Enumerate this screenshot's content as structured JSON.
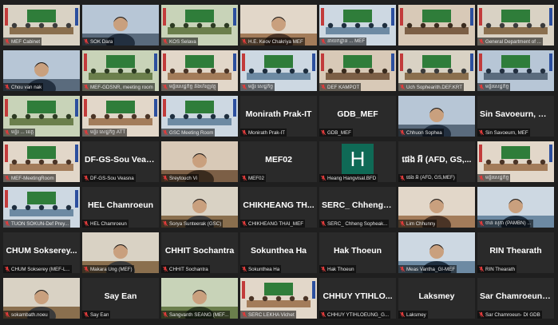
{
  "meeting": {
    "colors": {
      "background": "#1f1f1f",
      "tile": "#2a2a2a",
      "active_speaker": "#f2c230",
      "mic_muted": "#e03b3b"
    },
    "participants": [
      {
        "label": "MEF Cabinet",
        "name": "",
        "video": "video-room",
        "active": false
      },
      {
        "label": "SOK Dara",
        "name": "",
        "video": "video-person",
        "active": false
      },
      {
        "label": "KOS Selava",
        "name": "",
        "video": "video-room",
        "active": false
      },
      {
        "label": "H.E. Keov Chakriya MEF",
        "name": "",
        "video": "video-person",
        "active": false
      },
      {
        "label": "នាយកដ្ឋាន ... MEF",
        "name": "",
        "video": "video-room",
        "active": false
      },
      {
        "label": "",
        "name": "",
        "video": "video-room",
        "active": false
      },
      {
        "label": "General Department of ...",
        "name": "",
        "video": "video-room",
        "active": false
      },
      {
        "label": "Chou van nak",
        "name": "",
        "video": "video-person",
        "active": false
      },
      {
        "label": "MEF-GDSNR, meeting room",
        "name": "",
        "video": "video-room",
        "active": false
      },
      {
        "label": "មន្ទីរសេដ្ឋកិច្ច និងហិរញ្ញវត្ថុ",
        "name": "",
        "video": "video-room",
        "active": false
      },
      {
        "label": "មន្ទីរ សេដ្ឋកិច្ច",
        "name": "",
        "video": "video-room",
        "active": false
      },
      {
        "label": "DEF KAMPOT",
        "name": "",
        "video": "video-room",
        "active": false
      },
      {
        "label": "Uch Sophearith.DEF.KRT",
        "name": "",
        "video": "video-room",
        "active": false
      },
      {
        "label": "មន្ទីរសេដ្ឋកិច្ច",
        "name": "",
        "video": "video-room",
        "active": false
      },
      {
        "label": "មន្ទីរ ... ខេត្ត",
        "name": "",
        "video": "video-room",
        "active": false
      },
      {
        "label": "មន្ទីរ សេដ្ឋកិច្ច ATT",
        "name": "",
        "video": "video-room",
        "active": false
      },
      {
        "label": "GSC Meeting Room",
        "name": "",
        "video": "video-room",
        "active": false
      },
      {
        "label": "Monirath Prak-IT",
        "name": "Monirath Prak-IT",
        "video": "none",
        "active": false
      },
      {
        "label": "GDB_MEF",
        "name": "GDB_MEF",
        "video": "none",
        "active": false
      },
      {
        "label": "Chhuon Sophea",
        "name": "",
        "video": "video-person",
        "active": false
      },
      {
        "label": "Sin Savoeurn, MEF",
        "name": "Sin Savoeurn, M...",
        "video": "none",
        "active": false
      },
      {
        "label": "MEF-MeetingRoom",
        "name": "",
        "video": "video-room",
        "active": false
      },
      {
        "label": "DF-GS-Sou Veasna",
        "name": "DF-GS-Sou Veas...",
        "video": "none",
        "active": false
      },
      {
        "label": "Sreytouch Vi",
        "name": "",
        "video": "video-person",
        "active": false
      },
      {
        "label": "MEF02",
        "name": "MEF02",
        "video": "none",
        "active": false
      },
      {
        "label": "Heang Hangvisal.BFD",
        "name": "",
        "video": "avatar-h",
        "avatar": "H",
        "active": false
      },
      {
        "label": "ផេង អ៊ី (AFD, GS,MEF)",
        "name": "ផេង អ៊ី (AFD, GS,...",
        "video": "none",
        "active": false
      },
      {
        "label": "មន្ទីរសេដ្ឋកិច្ច",
        "name": "",
        "video": "video-room",
        "active": false
      },
      {
        "label": "TUON SOKUN-Def Prey...",
        "name": "",
        "video": "video-room",
        "active": true
      },
      {
        "label": "HEL Chamroeun",
        "name": "HEL Chamroeun",
        "video": "none",
        "active": false
      },
      {
        "label": "Sorya Sunteerak (GSC)",
        "name": "",
        "video": "video-person",
        "active": false
      },
      {
        "label": "CHIKHEANG THAI_MEF",
        "name": "CHIKHEANG TH...",
        "video": "none",
        "active": false
      },
      {
        "label": "SERC_ Chheng Sopheak...",
        "name": "SERC_ Chheng S...",
        "video": "none",
        "active": false
      },
      {
        "label": "Lim Chhunny",
        "name": "",
        "video": "video-person",
        "active": false
      },
      {
        "label": "ចាន់ សុភា (PAMBN) ...",
        "name": "",
        "video": "video-person",
        "active": false
      },
      {
        "label": "CHUM Sokserey (MEF-L...",
        "name": "CHUM Sokserey...",
        "video": "none",
        "active": false
      },
      {
        "label": "Makara Ung (MEF)",
        "name": "",
        "video": "video-person",
        "active": false
      },
      {
        "label": "CHHIT Sochantra",
        "name": "CHHIT Sochantra",
        "video": "none",
        "active": false
      },
      {
        "label": "Sokunthea Ha",
        "name": "Sokunthea Ha",
        "video": "none",
        "active": false
      },
      {
        "label": "Hak Thoeun",
        "name": "Hak Thoeun",
        "video": "none",
        "active": false
      },
      {
        "label": "Meas Vantha_GI-MEF",
        "name": "",
        "video": "video-person",
        "active": false
      },
      {
        "label": "RIN Thearath",
        "name": "RIN Thearath",
        "video": "none",
        "active": false
      },
      {
        "label": "sokambath.noeu",
        "name": "",
        "video": "video-person",
        "active": false
      },
      {
        "label": "Say Ean",
        "name": "Say Ean",
        "video": "none",
        "active": false
      },
      {
        "label": "Sangvanth SEANG (MEF...",
        "name": "",
        "video": "video-person",
        "active": false
      },
      {
        "label": "SERC LEKHA Vichet",
        "name": "",
        "video": "video-room",
        "active": false
      },
      {
        "label": "CHHUY YTIHLOEUNG_G...",
        "name": "CHHUY YTIHLO...",
        "video": "none",
        "active": false
      },
      {
        "label": "Laksmey",
        "name": "Laksmey",
        "video": "none",
        "active": false
      },
      {
        "label": "Sar Chamroeun- DI GDB",
        "name": "Sar Chamroeun-...",
        "video": "none",
        "active": false
      }
    ]
  }
}
